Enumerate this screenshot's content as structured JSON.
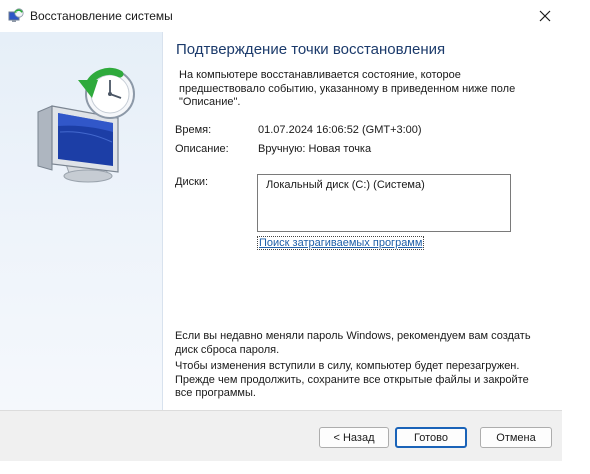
{
  "window": {
    "title": "Восстановление системы"
  },
  "main": {
    "heading": "Подтверждение точки восстановления",
    "description": "На компьютере восстанавливается состояние, которое предшествовало событию, указанному в приведенном ниже поле \"Описание\".",
    "time_label": "Время:",
    "time_value": "01.07.2024 16:06:52 (GMT+3:00)",
    "description_label": "Описание:",
    "description_value": "Вручную: Новая точка",
    "disks_label": "Диски:",
    "disks": [
      "Локальный диск (C:) (Система)"
    ],
    "scan_link": "Поиск затрагиваемых программ",
    "password_note": "Если вы недавно меняли пароль Windows, рекомендуем вам создать диск сброса пароля.",
    "restart_note": "Чтобы изменения вступили в силу, компьютер будет перезагружен. Прежде чем продолжить, сохраните все открытые файлы и закройте все программы."
  },
  "footer": {
    "back_label": "< Назад",
    "finish_label": "Готово",
    "cancel_label": "Отмена"
  },
  "icons": {
    "app": "system-restore-icon",
    "close": "close-icon",
    "hero": "system-restore-monitor-clock-icon"
  },
  "colors": {
    "heading": "#1b3a6b",
    "link": "#1f5fa8",
    "primary_border": "#1a63b8",
    "sidebar": "#e6eff8"
  }
}
